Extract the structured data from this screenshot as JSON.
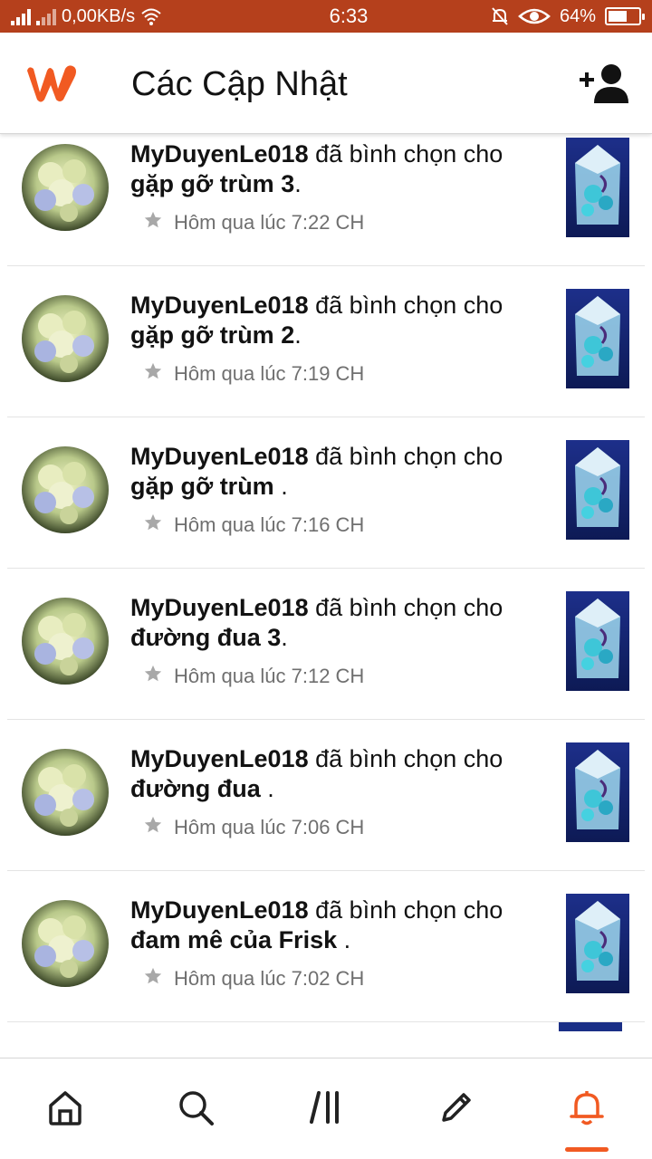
{
  "status_bar": {
    "network_speed": "0,00KB/s",
    "time": "6:33",
    "battery_percent": "64%",
    "battery_level": 0.64
  },
  "header": {
    "title": "Các Cập Nhật",
    "logo_icon": "wattpad-logo",
    "action_icon": "add-user-icon"
  },
  "colors": {
    "brand": "#f15a22",
    "status_bar": "#b5401c",
    "meta_text": "#6f6f6f"
  },
  "feed": {
    "items": [
      {
        "user": "MyDuyenLe018",
        "action": " đã bình chọn cho ",
        "story": "gặp gỡ trùm 3",
        "suffix": ".",
        "time": "Hôm qua lúc 7:22 CH"
      },
      {
        "user": "MyDuyenLe018",
        "action": " đã bình chọn cho ",
        "story": "gặp gỡ trùm 2",
        "suffix": ".",
        "time": "Hôm qua lúc 7:19 CH"
      },
      {
        "user": "MyDuyenLe018",
        "action": " đã bình chọn cho ",
        "story": "gặp gỡ trùm ",
        "suffix": ".",
        "time": "Hôm qua lúc 7:16 CH"
      },
      {
        "user": "MyDuyenLe018",
        "action": " đã bình chọn cho ",
        "story": "đường đua 3",
        "suffix": ".",
        "time": "Hôm qua lúc 7:12 CH"
      },
      {
        "user": "MyDuyenLe018",
        "action": " đã bình chọn cho ",
        "story": "đường đua ",
        "suffix": ".",
        "time": "Hôm qua lúc 7:06 CH"
      },
      {
        "user": "MyDuyenLe018",
        "action": " đã bình chọn cho ",
        "story": "đam mê của Frisk ",
        "suffix": ".",
        "time": "Hôm qua lúc 7:02 CH"
      }
    ]
  },
  "bottom_nav": {
    "items": [
      {
        "icon": "home-icon"
      },
      {
        "icon": "search-icon"
      },
      {
        "icon": "library-icon"
      },
      {
        "icon": "write-icon"
      },
      {
        "icon": "notifications-bell-icon",
        "active": true
      }
    ]
  }
}
